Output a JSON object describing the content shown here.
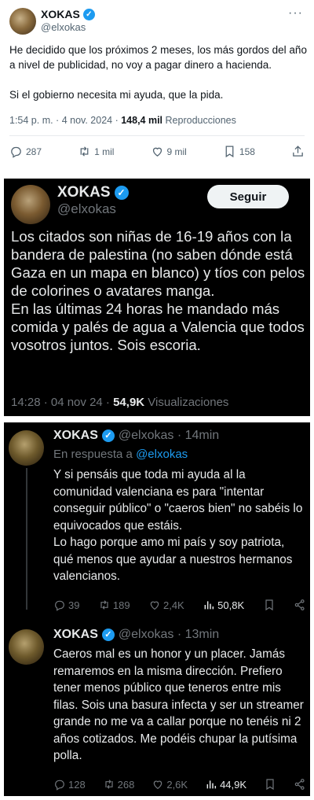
{
  "tweet1": {
    "name": "XOKAS",
    "handle": "@elxokas",
    "more": "···",
    "paragraphs": [
      "He decidido que los próximos 2 meses, los más gordos del año a nivel de publicidad, no voy a pagar dinero a hacienda.",
      "Si el gobierno necesita mi ayuda, que la pida."
    ],
    "time": "1:54 p. m. · 4 nov. 2024 · ",
    "views": "148,4 mil",
    "views_label": " Reproducciones",
    "replies": "287",
    "retweets": "1 mil",
    "likes": "9 mil",
    "bookmarks": "158"
  },
  "tweet2": {
    "name": "XOKAS",
    "handle": "@elxokas",
    "follow_label": "Seguir",
    "text": "Los citados son niñas de 16-19 años con la bandera de palestina (no saben dónde está Gaza en un mapa en blanco) y tíos con pelos de colorines o avatares manga.\nEn las últimas 24 horas he mandado más comida y palés de agua a Valencia que todos vosotros juntos. Sois escoria.",
    "time": "14:28 · 04 nov 24 · ",
    "views": "54,9K",
    "views_label": " Visualizaciones"
  },
  "tweet3": {
    "name": "XOKAS",
    "handle_time": "@elxokas · 14min",
    "in_reply_prefix": "En respuesta a ",
    "in_reply_handle": "@elxokas",
    "text": "Y si pensáis que toda mi ayuda al la comunidad valenciana es para \"intentar conseguir público\" o \"caeros bien\" no sabéis lo equivocados que estáis.\nLo hago porque amo mi país y soy patriota, qué menos que ayudar a nuestros hermanos valencianos.",
    "replies": "39",
    "retweets": "189",
    "likes": "2,4K",
    "views": "50,8K"
  },
  "tweet4": {
    "name": "XOKAS",
    "handle_time": "@elxokas · 13min",
    "text": "Caeros mal es un honor y un placer. Jamás remaremos en la misma dirección. Prefiero tener menos público que teneros entre mis filas. Sois una basura infecta y ser un streamer grande no me va a callar porque no tenéis ni 2 años cotizados. Me podéis chupar la putísima polla.",
    "replies": "128",
    "retweets": "268",
    "likes": "2,6K",
    "views": "44,9K"
  },
  "colors": {
    "verified": "#1d9bf0",
    "dark_bg": "#000000",
    "muted": "#71767b"
  },
  "icons": {
    "verified": "✓"
  }
}
